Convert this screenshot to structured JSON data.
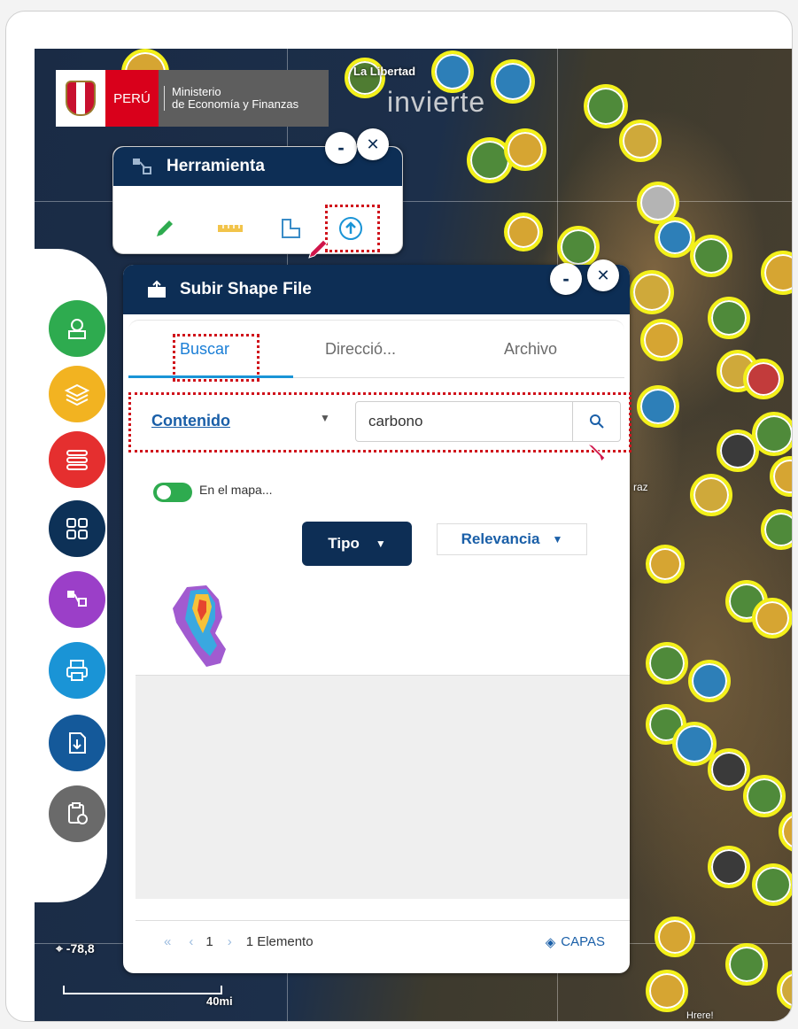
{
  "map": {
    "label_region": "La Libertad",
    "watermark": "invierte",
    "place_label": "raz",
    "coord_readout": "-78,8",
    "scale_label": "40mi",
    "corner_label": "Hrere!"
  },
  "header": {
    "peru_label": "PERÚ",
    "ministry_line1": "Ministerio",
    "ministry_line2": "de Economía y Finanzas"
  },
  "herramienta": {
    "title": "Herramienta",
    "minimize": "-",
    "close": "✕",
    "tools": [
      "pencil-icon",
      "ruler-icon",
      "shape-icon",
      "upload-icon"
    ]
  },
  "subir": {
    "title": "Subir Shape File",
    "minimize": "-",
    "close": "✕",
    "tabs": {
      "buscar": "Buscar",
      "direccion": "Direcció...",
      "archivo": "Archivo"
    },
    "content_select": "Contenido",
    "search_value": "carbono",
    "toggle_label": "En el mapa...",
    "tipo_button": "Tipo",
    "relevancia": "Relevancia",
    "pagination": {
      "page": "1",
      "count": "1 Elemento"
    },
    "capas": "CAPAS"
  },
  "sidebar_icons": [
    {
      "name": "money-tree-icon",
      "color": "#2eab4f"
    },
    {
      "name": "layers-icon",
      "color": "#f2b321"
    },
    {
      "name": "list-icon",
      "color": "#e52f2f"
    },
    {
      "name": "grid-icon",
      "color": "#0d3157"
    },
    {
      "name": "tools-icon",
      "color": "#9b3fc8"
    },
    {
      "name": "print-icon",
      "color": "#1a94d6"
    },
    {
      "name": "download-doc-icon",
      "color": "#14599a"
    },
    {
      "name": "clipboard-icon",
      "color": "#6a6a6a"
    }
  ]
}
